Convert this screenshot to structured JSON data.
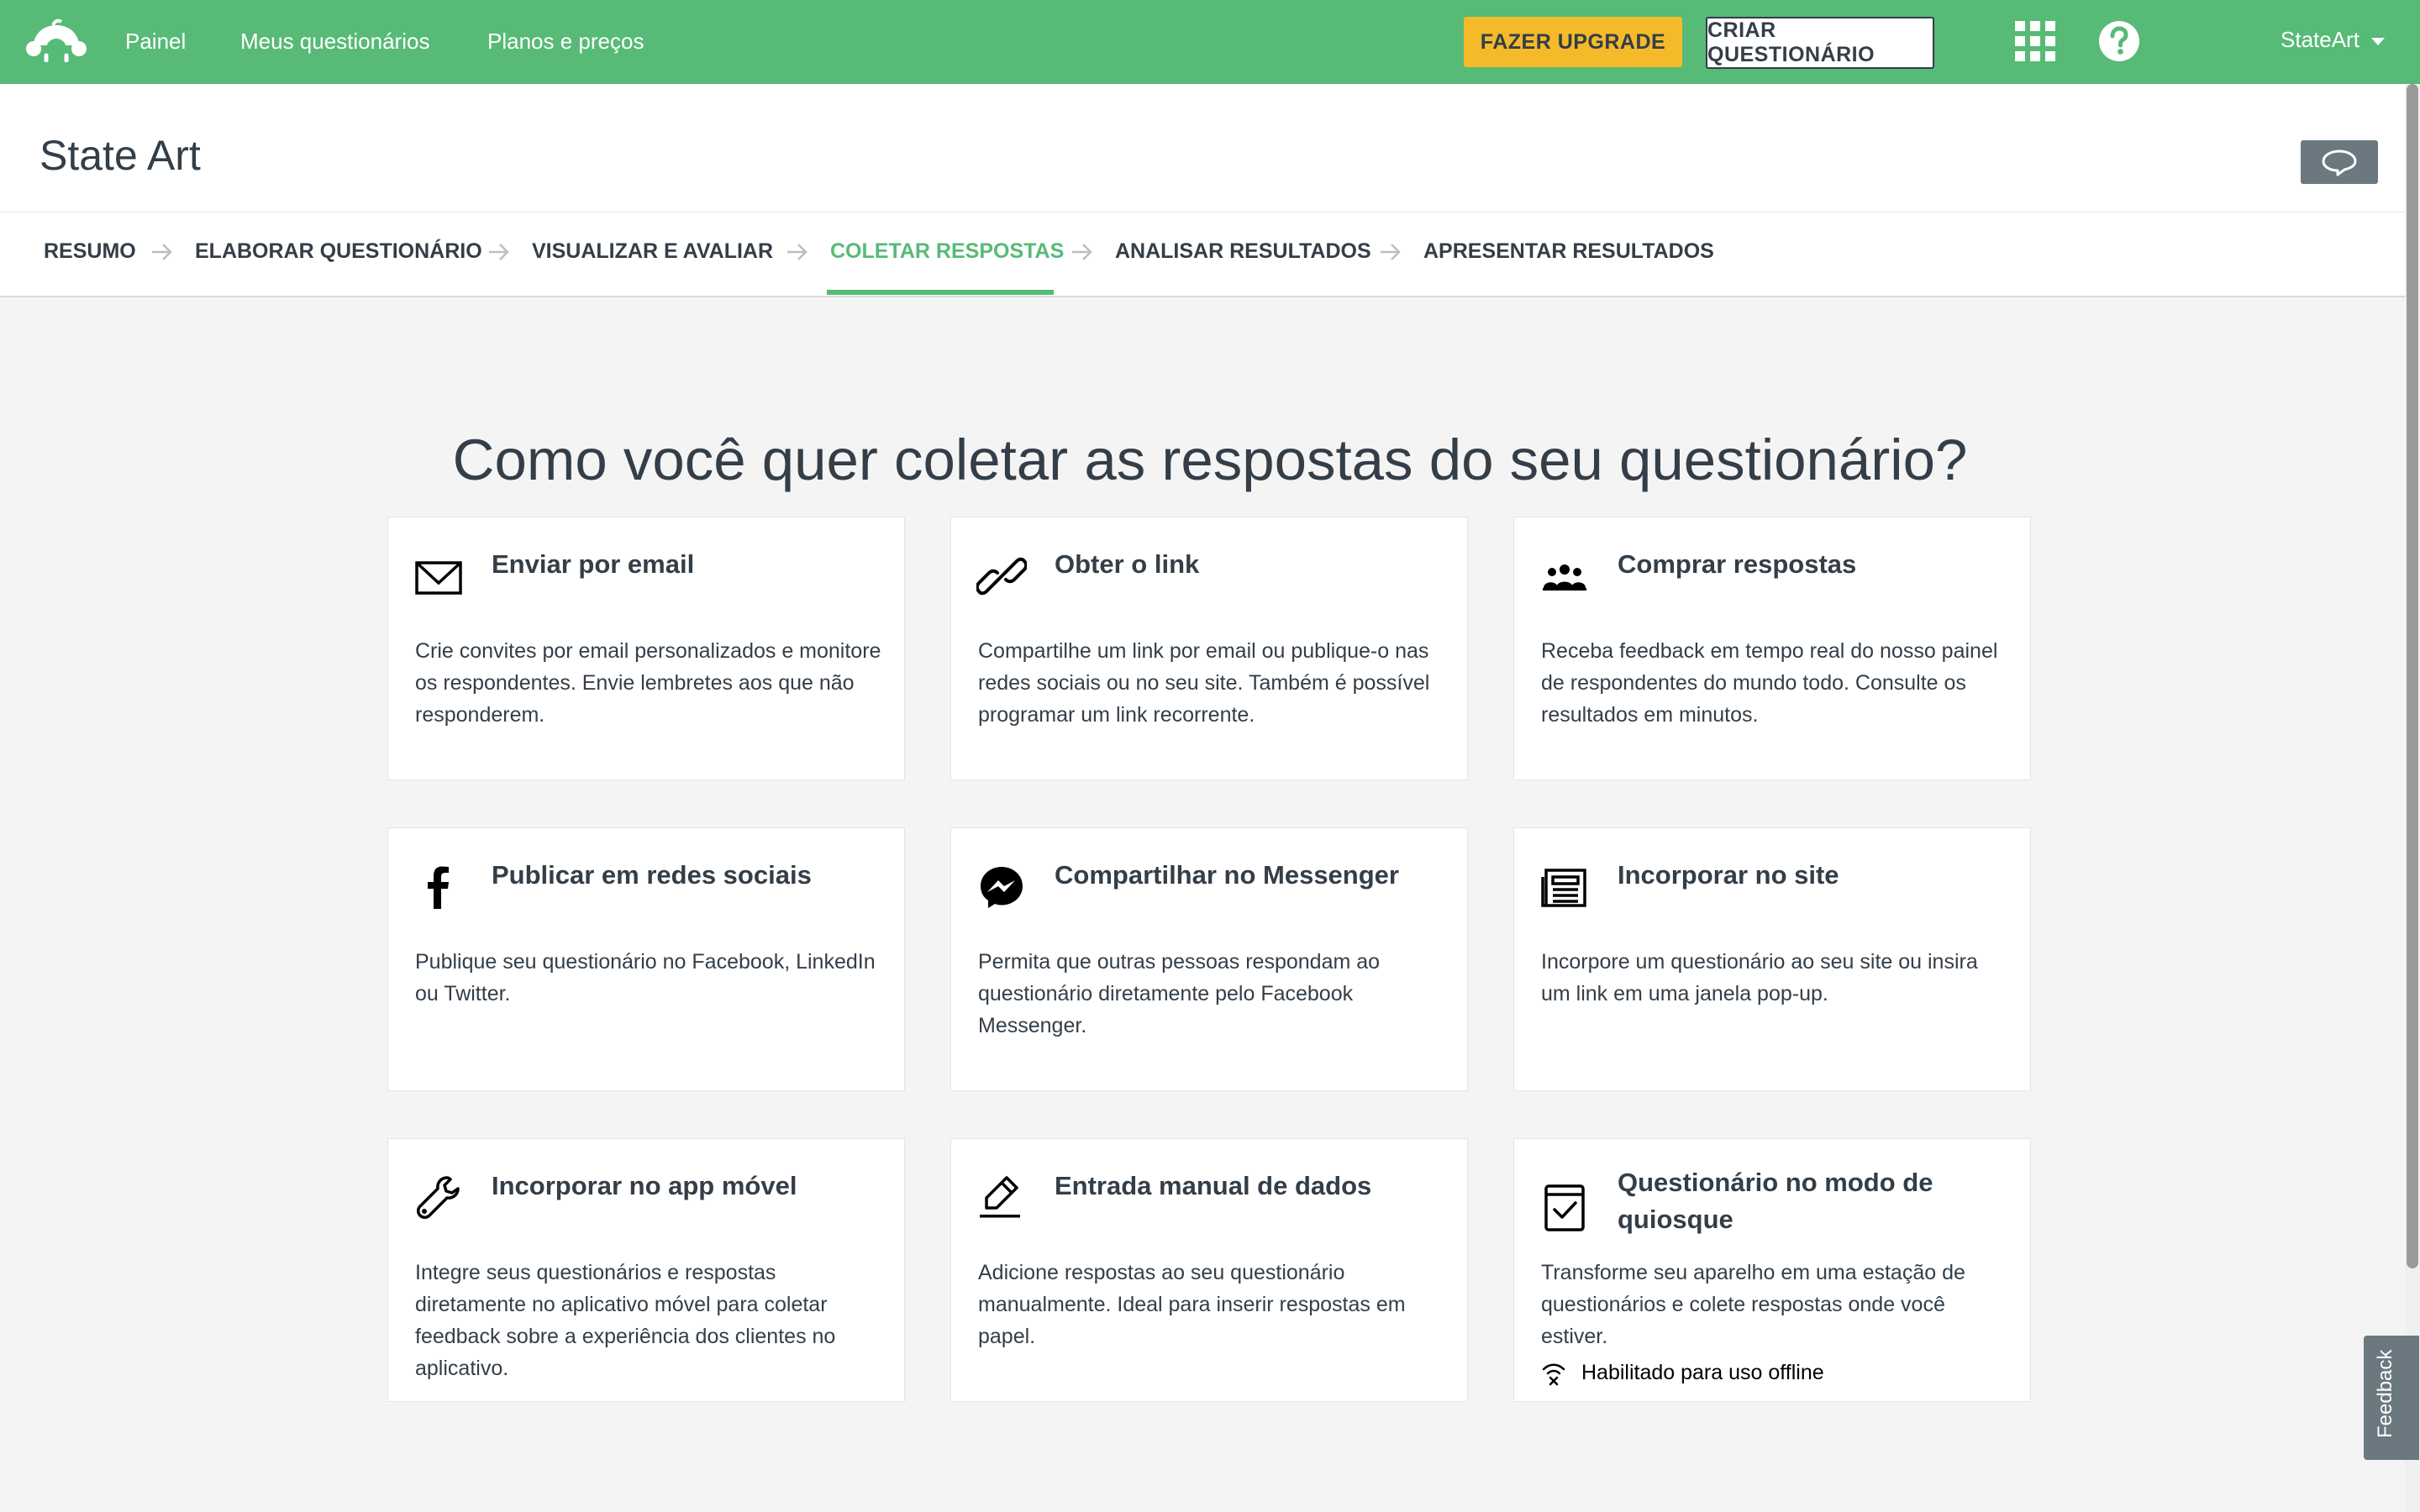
{
  "colors": {
    "brand_green": "#57ba77",
    "upgrade_yellow": "#f4ba2a",
    "text_dark": "#333e48"
  },
  "topbar": {
    "logo_icon": "surveymonkey-logo",
    "nav": [
      "Painel",
      "Meus questionários",
      "Planos e preços"
    ],
    "upgrade_label": "FAZER UPGRADE",
    "create_label": "CRIAR QUESTIONÁRIO",
    "apps_icon": "apps-grid-icon",
    "help_icon": "help-icon",
    "account_name": "StateArt"
  },
  "survey": {
    "title": "State Art",
    "comment_icon": "comment-icon"
  },
  "steps": {
    "active": "COLETAR RESPOSTAS",
    "items": [
      "RESUMO",
      "ELABORAR QUESTIONÁRIO",
      "VISUALIZAR E AVALIAR",
      "COLETAR RESPOSTAS",
      "ANALISAR RESULTADOS",
      "APRESENTAR RESULTADOS"
    ]
  },
  "main": {
    "headline": "Como você quer coletar as respostas do seu questionário?",
    "cards": [
      {
        "icon": "email-icon",
        "title": "Enviar por email",
        "desc": "Crie convites por email personalizados e monitore os respondentes. Envie lembretes aos que não responderem."
      },
      {
        "icon": "link-icon",
        "title": "Obter o link",
        "desc": "Compartilhe um link por email ou publique-o nas redes sociais ou no seu site. Também é possível programar um link recorrente."
      },
      {
        "icon": "people-icon",
        "title": "Comprar respostas",
        "desc": "Receba feedback em tempo real do nosso painel de respondentes do mundo todo. Consulte os resultados em minutos."
      },
      {
        "icon": "facebook-icon",
        "title": "Publicar em redes sociais",
        "desc": "Publique seu questionário no Facebook, LinkedIn ou Twitter."
      },
      {
        "icon": "messenger-icon",
        "title": "Compartilhar no Messenger",
        "desc": "Permita que outras pessoas respondam ao questionário diretamente pelo Facebook Messenger."
      },
      {
        "icon": "embed-website-icon",
        "title": "Incorporar no site",
        "desc": "Incorpore um questionário ao seu site ou insira um link em uma janela pop-up."
      },
      {
        "icon": "wrench-icon",
        "title": "Incorporar no app móvel",
        "desc": "Integre seus questionários e respostas diretamente no aplicativo móvel para coletar feedback sobre a experiência dos clientes no aplicativo."
      },
      {
        "icon": "pencil-icon",
        "title": "Entrada manual de dados",
        "desc": "Adicione respostas ao seu questionário manualmente. Ideal para inserir respostas em papel."
      },
      {
        "icon": "kiosk-icon",
        "title": "Questionário no modo de quiosque",
        "desc": "Transforme seu aparelho em uma estação de questionários e colete respostas onde você estiver.",
        "badge": "Habilitado para uso offline",
        "badge_icon": "offline-wifi-icon"
      }
    ]
  },
  "feedback_tab": "Feedback"
}
